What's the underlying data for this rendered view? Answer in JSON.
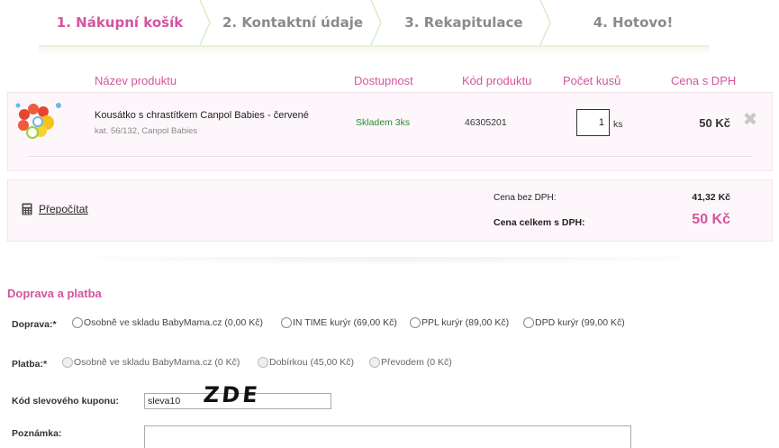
{
  "steps": [
    {
      "label": "1. Nákupní košík",
      "active": true
    },
    {
      "label": "2. Kontaktní údaje",
      "active": false
    },
    {
      "label": "3. Rekapitulace",
      "active": false
    },
    {
      "label": "4. Hotovo!",
      "active": false
    }
  ],
  "table_header": {
    "name": "Název produktu",
    "availability": "Dostupnost",
    "code": "Kód produktu",
    "quantity": "Počet kusů",
    "price": "Cena s DPH"
  },
  "product": {
    "name": "Kousátko s chrastítkem Canpol Babies - červené",
    "meta": "kat. 56/132, Canpol Babies",
    "availability": "Skladem 3ks",
    "code": "46305201",
    "quantity": "1",
    "unit": "ks",
    "price": "50 Kč"
  },
  "summary": {
    "recalc_label": "Přepočítat",
    "price_without_vat_label": "Cena bez DPH:",
    "price_without_vat": "41,32 Kč",
    "total_label": "Cena celkem s DPH:",
    "total": "50 Kč"
  },
  "shipping_payment": {
    "title": "Doprava a platba",
    "shipping_label": "Doprava:*",
    "shipping_options": [
      "Osobně ve skladu BabyMama.cz (0,00 Kč)",
      "IN TIME kurýr (69,00 Kč)",
      "PPL kurýr (89,00 Kč)",
      "DPD kurýr (99,00 Kč)"
    ],
    "payment_label": "Platba:*",
    "payment_options": [
      "Osobně ve skladu BabyMama.cz (0 Kč)",
      "Dobírkou (45,00 Kč)",
      "Převodem (0 Kč)"
    ],
    "coupon_label": "Kód slevového kuponu:",
    "coupon_value": "sleva10",
    "coupon_annotation": "ZDE",
    "note_label": "Poznámka:",
    "note_value": ""
  },
  "colors": {
    "accent": "#d4559f",
    "stock_green": "#2e8b2e"
  },
  "icons": {
    "recalc": "calculator-icon",
    "remove": "close-icon",
    "radio": "radio-button"
  }
}
